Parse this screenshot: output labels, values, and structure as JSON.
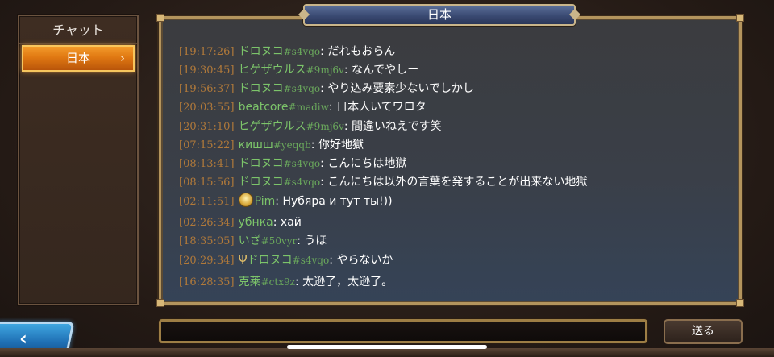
{
  "sidebar": {
    "title": "チャット",
    "items": [
      {
        "label": "日本",
        "chevron": "›",
        "active": true
      }
    ]
  },
  "header": {
    "title": "日本"
  },
  "messages": [
    {
      "time": "[19:17:26]",
      "name": "ドロヌコ",
      "tag": "#s4vqo",
      "sep": ": ",
      "text": "だれもおらん"
    },
    {
      "time": "[19:30:45]",
      "name": "ヒゲザウルス",
      "tag": "#9mj6v",
      "sep": ": ",
      "text": "なんでやしー"
    },
    {
      "time": "[19:56:37]",
      "name": "ドロヌコ",
      "tag": "#s4vqo",
      "sep": ": ",
      "text": "やり込み要素少ないでしかし"
    },
    {
      "time": "[20:03:55]",
      "name": "beatcore",
      "tag": "#madiw",
      "sep": ": ",
      "text": "日本人いてワロタ"
    },
    {
      "time": "[20:31:10]",
      "name": "ヒゲザウルス",
      "tag": "#9mj6v",
      "sep": ": ",
      "text": "間違いねえです笑"
    },
    {
      "time": "[07:15:22]",
      "name": "кишш",
      "tag": "#yeqqb",
      "sep": ": ",
      "text": "你好地獄"
    },
    {
      "time": "[08:13:41]",
      "name": "ドロヌコ",
      "tag": "#s4vqo",
      "sep": ": ",
      "text": "こんにちは地獄"
    },
    {
      "time": "[08:15:56]",
      "name": "ドロヌコ",
      "tag": "#s4vqo",
      "sep": ": ",
      "text": "こんにちは以外の言葉を発することが出来ない地獄"
    },
    {
      "time": "[02:11:51]",
      "name": "Pim",
      "tag": "",
      "sep": ": ",
      "text": "Нубяра и тут ты!))",
      "icon": "guild-badge-icon"
    },
    {
      "time": "[02:26:34]",
      "name": "убнка",
      "tag": "",
      "sep": ": ",
      "text": "хай"
    },
    {
      "time": "[18:35:05]",
      "name": "いざ",
      "tag": "#50vyr",
      "sep": ": ",
      "text": "うほ"
    },
    {
      "time": "[20:29:34]",
      "name": "ドロヌコ",
      "tag": "#s4vqo",
      "sep": ": ",
      "text": "やらないか",
      "icon": "trident-icon"
    },
    {
      "time": "[16:28:35]",
      "name": "克莱",
      "tag": "#ctx9z",
      "sep": ": ",
      "text": "太逊了，太逊了。"
    }
  ],
  "input": {
    "placeholder": "",
    "value": ""
  },
  "send_button": {
    "label": "送る"
  },
  "back_button": {
    "icon": "chevron-left-icon",
    "glyph": "‹"
  },
  "colors": {
    "accent_orange": "#e07812",
    "name_green": "#7cc46a",
    "timestamp_brown": "#b0793a",
    "frame_gold": "#b3945d",
    "back_blue": "#1f6fb4"
  }
}
